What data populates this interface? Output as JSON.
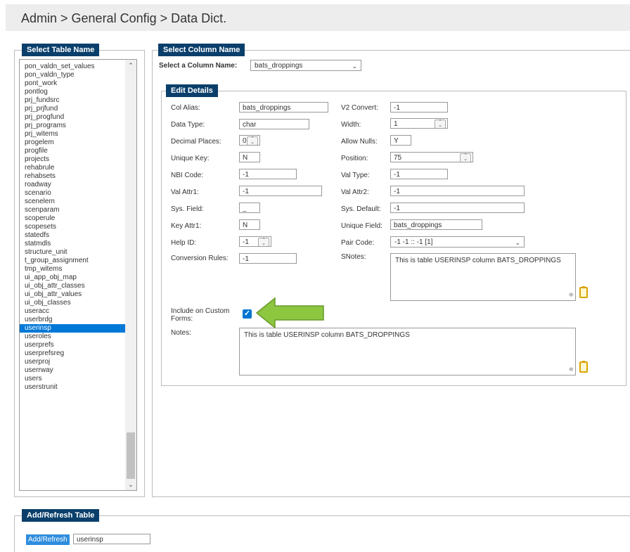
{
  "breadcrumb": "Admin > General Config > Data Dict.",
  "select_table": {
    "legend": "Select Table Name",
    "items": [
      "pon_valdn_set_values",
      "pon_valdn_type",
      "pont_work",
      "pontlog",
      "prj_fundsrc",
      "prj_prjfund",
      "prj_progfund",
      "prj_programs",
      "prj_witems",
      "progelem",
      "progfile",
      "projects",
      "rehabrule",
      "rehabsets",
      "roadway",
      "scenario",
      "scenelem",
      "scenparam",
      "scoperule",
      "scopesets",
      "statedfs",
      "statmdls",
      "structure_unit",
      "t_group_assignment",
      "tmp_witems",
      "ui_app_obj_map",
      "ui_obj_attr_classes",
      "ui_obj_attr_values",
      "ui_obj_classes",
      "useracc",
      "userbrdg",
      "userinsp",
      "useroles",
      "userprefs",
      "userprefsreg",
      "userproj",
      "userrway",
      "users",
      "userstrunit"
    ],
    "selected": "userinsp"
  },
  "select_column": {
    "legend": "Select Column Name",
    "label": "Select a Column Name:",
    "value": "bats_droppings"
  },
  "edit_details": {
    "legend": "Edit Details",
    "col_alias_label": "Col Alias:",
    "col_alias": "bats_droppings",
    "v2_convert_label": "V2 Convert:",
    "v2_convert": "-1",
    "data_type_label": "Data Type:",
    "data_type": "char",
    "width_label": "Width:",
    "width": "1",
    "decimal_places_label": "Decimal Places:",
    "decimal_places": "0",
    "allow_nulls_label": "Allow Nulls:",
    "allow_nulls": "Y",
    "unique_key_label": "Unique Key:",
    "unique_key": "N",
    "position_label": "Position:",
    "position": "75",
    "nbi_code_label": "NBI Code:",
    "nbi_code": "-1",
    "val_type_label": "Val Type:",
    "val_type": "-1",
    "val_attr1_label": "Val Attr1:",
    "val_attr1": "-1",
    "val_attr2_label": "Val Attr2:",
    "val_attr2": "-1",
    "sys_field_label": "Sys. Field:",
    "sys_field": "_",
    "sys_default_label": "Sys. Default:",
    "sys_default": "-1",
    "key_attr1_label": "Key Attr1:",
    "key_attr1": "N",
    "unique_field_label": "Unique Field:",
    "unique_field": "bats_droppings",
    "help_id_label": "Help ID:",
    "help_id": "-1",
    "pair_code_label": "Pair Code:",
    "pair_code": "-1 -1 :: -1 [1]",
    "conversion_rules_label": "Conversion Rules:",
    "conversion_rules": "-1",
    "snotes_label": "SNotes:",
    "snotes": "This is table USERINSP column BATS_DROPPINGS",
    "include_custom_label_1": "Include on Custom",
    "include_custom_label_2": "Forms:",
    "include_custom_checked": true,
    "notes_label": "Notes:",
    "notes": "This is table USERINSP column BATS_DROPPINGS"
  },
  "add_refresh": {
    "legend": "Add/Refresh Table",
    "button": "Add/Refresh",
    "value": "userinsp"
  },
  "colors": {
    "legend_bg": "#0a3f6b",
    "selection": "#0078d7",
    "arrow": "#8dc63f",
    "button": "#2f8ddd"
  }
}
